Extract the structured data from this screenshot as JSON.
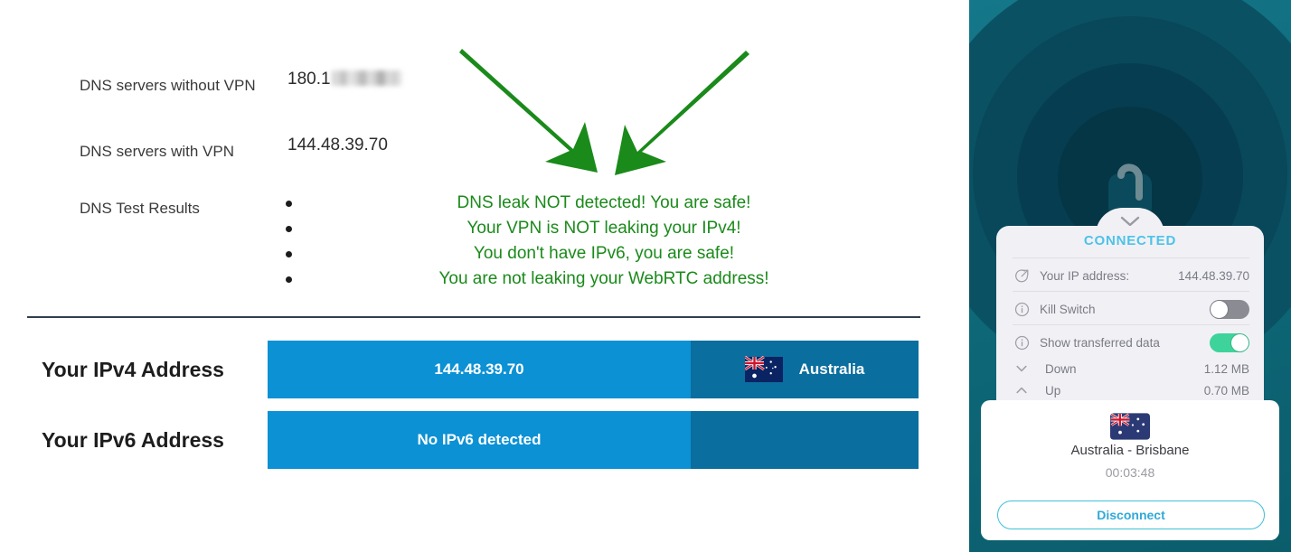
{
  "leak_test": {
    "rows": [
      {
        "label": "DNS servers without VPN",
        "value_prefix": "180.1",
        "redacted": true
      },
      {
        "label": "DNS servers with VPN",
        "value": "144.48.39.70"
      },
      {
        "label": "DNS Test Results"
      }
    ],
    "label_dns_without": "DNS servers without VPN",
    "label_dns_with": "DNS servers with VPN",
    "label_dns_results": "DNS Test Results",
    "value_dns_without_prefix": "180.1",
    "value_dns_with": "144.48.39.70",
    "results": [
      "DNS leak NOT detected! You are safe!",
      "Your VPN is NOT leaking your IPv4!",
      "You don't have IPv6, you are safe!",
      "You are not leaking your WebRTC address!"
    ],
    "success_color": "#1a8a1a",
    "arrow_color": "#1a8a1a"
  },
  "ip_section": {
    "ipv4_label": "Your IPv4 Address",
    "ipv4_value": "144.48.39.70",
    "ipv4_country": "Australia",
    "ipv6_label": "Your IPv6 Address",
    "ipv6_value": "No IPv6 detected",
    "ipv6_country": "",
    "bar_color": "#0b91d4",
    "bar_country_color": "#0a6e9e"
  },
  "vpn_panel": {
    "status": "CONNECTED",
    "status_color": "#4ec2e8",
    "rows": [
      {
        "icon": "external-link-icon",
        "label": "Your IP address:",
        "value": "144.48.39.70"
      },
      {
        "icon": "info-icon",
        "label": "Kill Switch",
        "toggle": "off"
      },
      {
        "icon": "info-icon",
        "label": "Show transferred data",
        "toggle": "on"
      },
      {
        "icon": "chevron-down-icon",
        "label": "Down",
        "value": "1.12 MB"
      },
      {
        "icon": "chevron-up-icon",
        "label": "Up",
        "value": "0.70 MB"
      }
    ],
    "ip_label": "Your IP address:",
    "ip_value": "144.48.39.70",
    "kill_switch_label": "Kill Switch",
    "kill_switch_state": "off",
    "show_data_label": "Show transferred data",
    "show_data_state": "on",
    "down_label": "Down",
    "down_value": "1.12 MB",
    "up_label": "Up",
    "up_value": "0.70 MB",
    "server_name": "Australia - Brisbane",
    "timer": "00:03:48",
    "disconnect_label": "Disconnect",
    "toggle_on_color": "#3ed39b",
    "toggle_off_color": "#8b8b94",
    "accent_color": "#3fc0d8"
  }
}
